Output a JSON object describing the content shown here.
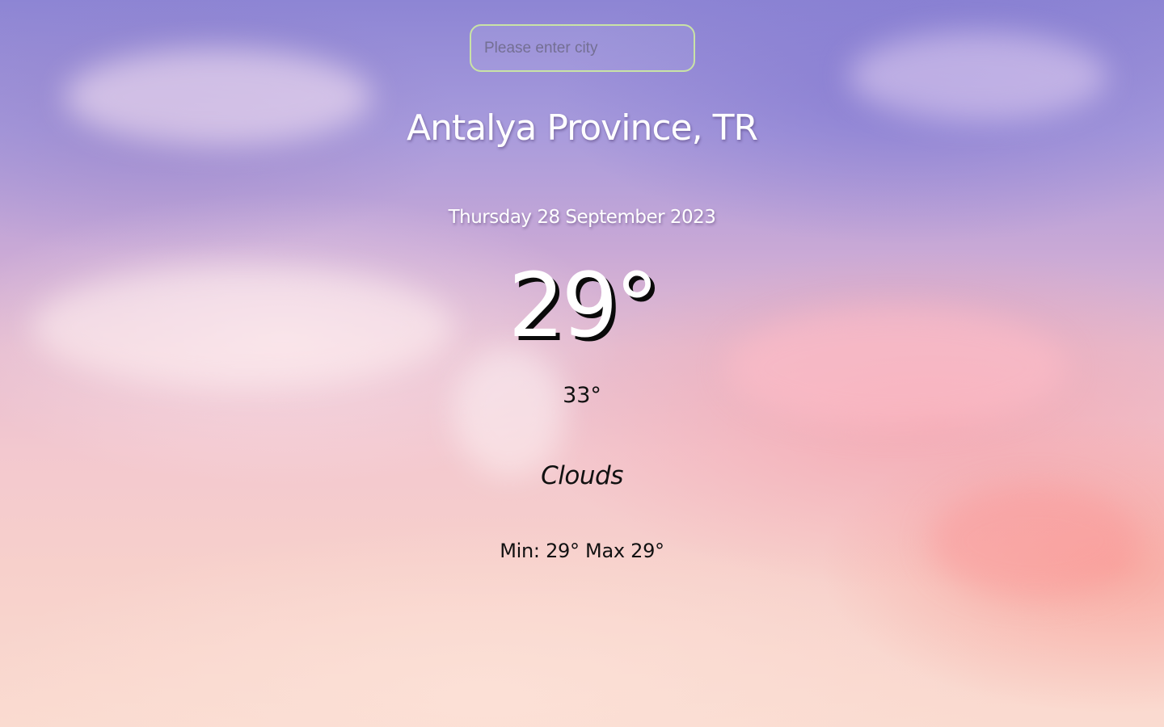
{
  "search": {
    "placeholder": "Please enter city",
    "value": ""
  },
  "weather": {
    "location": "Antalya Province, TR",
    "date": "Thursday 28 September 2023",
    "temperature": "29°",
    "feels_like": "33°",
    "condition": "Clouds",
    "min_label": "Min:",
    "min_value": "29°",
    "max_label": "Max",
    "max_value": "29°"
  },
  "colors": {
    "input_border": "#c9e3a6",
    "primary_text": "#ffffff",
    "secondary_text": "#111111"
  }
}
